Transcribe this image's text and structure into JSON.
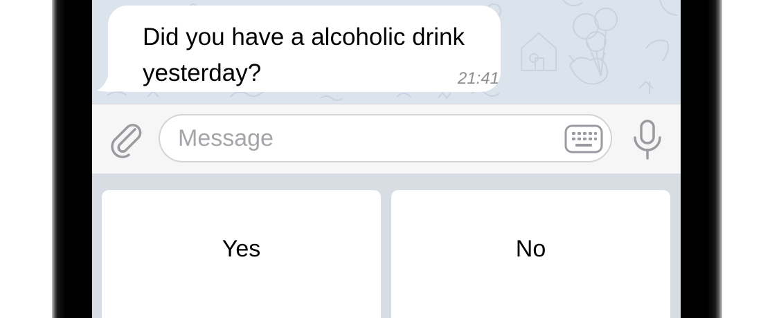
{
  "message": {
    "text": "Did you have a alcoholic drink yesterday?",
    "time": "21:41"
  },
  "composer": {
    "placeholder": "Message",
    "value": ""
  },
  "icons": {
    "attach": "paperclip-icon",
    "keyboard": "keyboard-icon",
    "mic": "microphone-icon"
  },
  "reply_keyboard": {
    "buttons": [
      {
        "label": "Yes"
      },
      {
        "label": "No"
      }
    ]
  },
  "colors": {
    "chat_background": "#dbe3ec",
    "bubble": "#ffffff",
    "input_bar": "#f6f6f6",
    "keyboard_background": "#d8dde4",
    "icon_gray": "#9a9aa0"
  }
}
